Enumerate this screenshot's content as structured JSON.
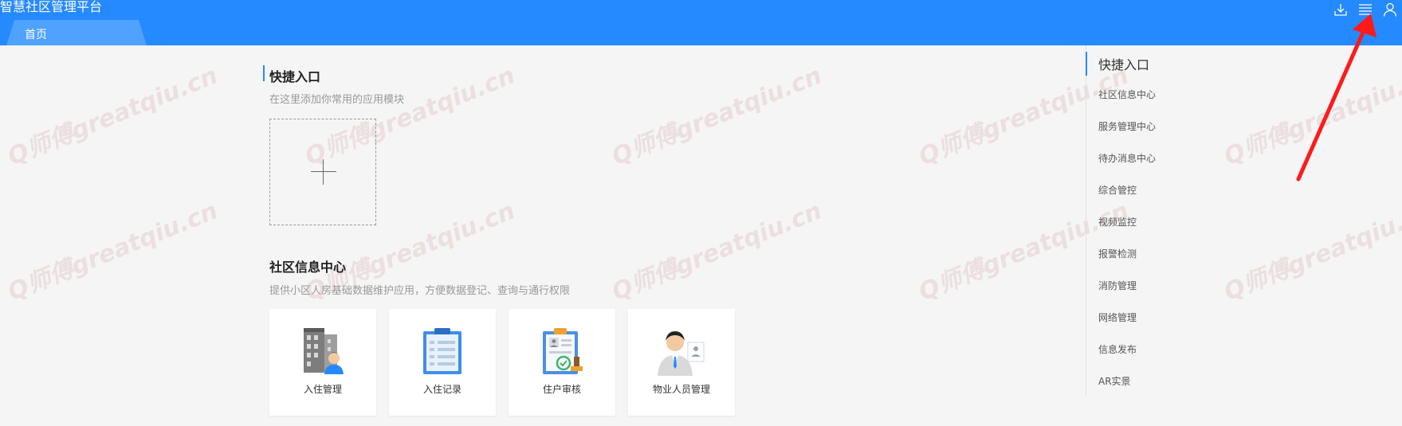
{
  "app": {
    "title": "智慧社区管理平台"
  },
  "tabs": [
    {
      "label": "首页"
    }
  ],
  "header_icons": [
    "download-icon",
    "menu-icon",
    "user-icon"
  ],
  "quick_entry": {
    "title": "快捷入口",
    "desc": "在这里添加你常用的应用模块"
  },
  "info_center": {
    "title": "社区信息中心",
    "desc": "提供小区人房基础数据维护应用，方便数据登记、查询与通行权限",
    "cards": [
      {
        "label": "入住管理",
        "icon": "building-resident-icon"
      },
      {
        "label": "入住记录",
        "icon": "clipboard-icon"
      },
      {
        "label": "住户审核",
        "icon": "audit-stamp-icon"
      },
      {
        "label": "物业人员管理",
        "icon": "staff-icon"
      }
    ]
  },
  "sidebar": {
    "title": "快捷入口",
    "items": [
      "社区信息中心",
      "服务管理中心",
      "待办消息中心",
      "综合管控",
      "视频监控",
      "报警检测",
      "消防管理",
      "网络管理",
      "信息发布",
      "AR实景"
    ]
  },
  "watermark": {
    "text": "Q师傅greatqiu.cn"
  },
  "colors": {
    "primary": "#2589ff",
    "tab": "#4fa2ff",
    "background": "#f5f5f5",
    "arrow": "#ff1a1a"
  }
}
